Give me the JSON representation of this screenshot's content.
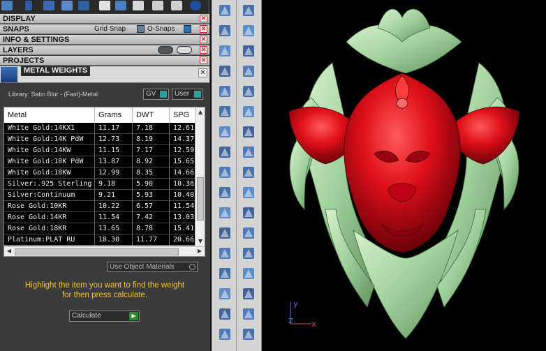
{
  "panel": {
    "sections": [
      {
        "label": "DISPLAY"
      },
      {
        "label": "SNAPS",
        "grid_snap": "Grid Snap",
        "o_snaps": "O-Snaps"
      },
      {
        "label": "INFO & SETTINGS"
      },
      {
        "label": "LAYERS"
      },
      {
        "label": "PROJECTS"
      }
    ],
    "metal_weights": {
      "title": "METAL WEIGHTS",
      "library": "Library: Satin Blur - (Fast)-Metal",
      "gv_label": "GV",
      "user_label": "User",
      "columns": [
        "Metal",
        "Grams",
        "DWT",
        "SPG"
      ],
      "rows": [
        [
          "White Gold:14KX1",
          "11.17",
          "7.18",
          "12.61"
        ],
        [
          "White Gold:14K PdW",
          "12.73",
          "8.19",
          "14.37"
        ],
        [
          "White Gold:14KW",
          "11.15",
          "7.17",
          "12.59"
        ],
        [
          "White Gold:18K PdW",
          "13.87",
          "8.92",
          "15.65"
        ],
        [
          "White Gold:18KW",
          "12.99",
          "8.35",
          "14.66"
        ],
        [
          "Silver:.925 Sterling",
          "9.18",
          "5.90",
          "10.36"
        ],
        [
          "Silver:Continuum",
          "9.21",
          "5.93",
          "10.40"
        ],
        [
          "Rose Gold:10KR",
          "10.22",
          "6.57",
          "11.54"
        ],
        [
          "Rose Gold:14KR",
          "11.54",
          "7.42",
          "13.03"
        ],
        [
          "Rose Gold:18KR",
          "13.65",
          "8.78",
          "15.41"
        ],
        [
          "Platinum:PLAT RU",
          "18.30",
          "11.77",
          "20.66"
        ]
      ],
      "use_object_materials": "Use Object Materials",
      "hint_line1": "Highlight the item you want to find the weight",
      "hint_line2": "for then press calculate.",
      "calculate": "Calculate"
    }
  },
  "viewport": {
    "axis_y": "y",
    "axis_z": "Z",
    "axis_x": "x",
    "model": "lion-head-pendant",
    "colors": {
      "face": "#e0101a",
      "mane": "#a8d8a8",
      "background": "#000000"
    }
  },
  "colors": {
    "panel_bg": "#3b3b3b",
    "section_bar": "#c4c4c4",
    "hint_text": "#f2c12e",
    "toggle_teal": "#2d9e9e",
    "close_red": "#c23030"
  }
}
